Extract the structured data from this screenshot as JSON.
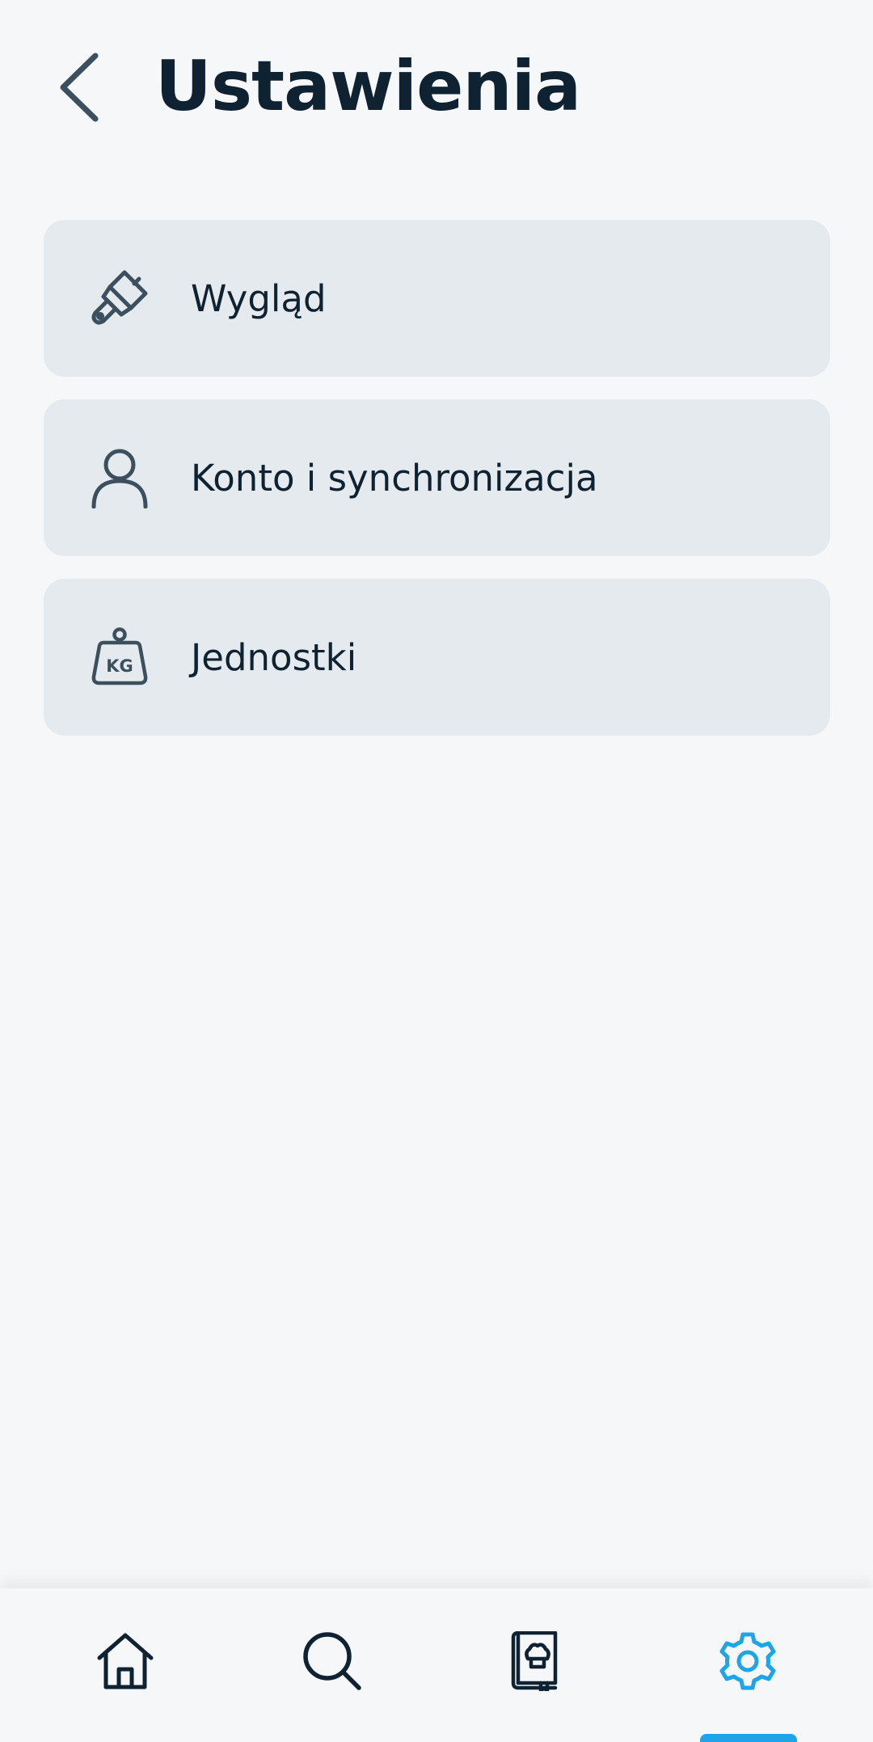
{
  "header": {
    "title": "Ustawienia",
    "back_icon": "chevron-left-icon"
  },
  "menu": {
    "items": [
      {
        "label": "Wygląd",
        "icon": "paint-brush-icon"
      },
      {
        "label": "Konto i synchronizacja",
        "icon": "user-icon"
      },
      {
        "label": "Jednostki",
        "icon": "kg-weight-icon",
        "icon_text": "KG"
      }
    ]
  },
  "bottom_nav": {
    "items": [
      {
        "name": "home",
        "icon": "home-icon",
        "active": false
      },
      {
        "name": "search",
        "icon": "search-icon",
        "active": false
      },
      {
        "name": "cookbook",
        "icon": "cookbook-icon",
        "active": false
      },
      {
        "name": "settings",
        "icon": "gear-icon",
        "active": true
      }
    ]
  },
  "colors": {
    "background": "#f5f7f9",
    "card": "#e4eaed",
    "text": "#0f2232",
    "icon": "#3b4f5e",
    "accent": "#1ea5e9"
  }
}
